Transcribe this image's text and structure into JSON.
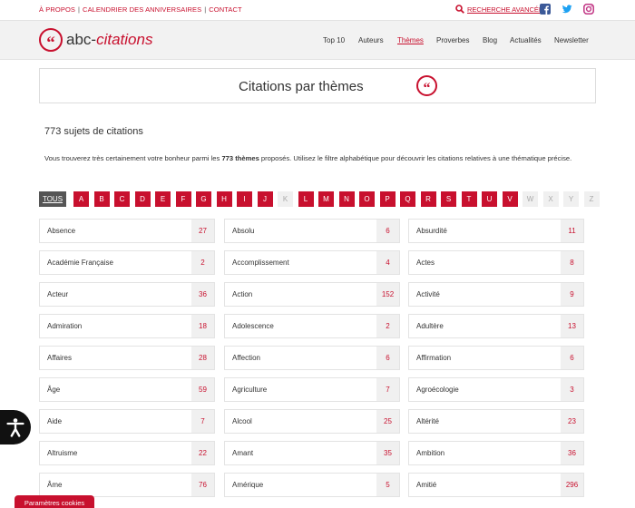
{
  "topbar": {
    "links": [
      "À PROPOS",
      "CALENDRIER DES ANNIVERSAIRES",
      "CONTACT"
    ],
    "search_label": "RECHERCHE AVANCÉE"
  },
  "header": {
    "logo_prefix": "abc-",
    "logo_highlight": "citations",
    "logo_mark": "“",
    "nav": [
      "Top 10",
      "Auteurs",
      "Thèmes",
      "Proverbes",
      "Blog",
      "Actualités",
      "Newsletter"
    ],
    "active_nav": "Thèmes"
  },
  "page": {
    "title": "Citations par thèmes",
    "title_mark": "“",
    "count_title": "773 sujets de citations",
    "intro_before": "Vous trouverez très certainement votre bonheur parmi les ",
    "intro_bold": "773 thèmes",
    "intro_after": " proposés. Utilisez le filtre alphabétique pour découvrir les citations relatives à une thématique précise."
  },
  "letters": {
    "tous": "TOUS",
    "items": [
      "A",
      "B",
      "C",
      "D",
      "E",
      "F",
      "G",
      "H",
      "I",
      "J",
      "K",
      "L",
      "M",
      "N",
      "O",
      "P",
      "Q",
      "R",
      "S",
      "T",
      "U",
      "V",
      "W",
      "X",
      "Y",
      "Z"
    ],
    "disabled": [
      "K",
      "W",
      "X",
      "Y",
      "Z"
    ]
  },
  "themes": [
    {
      "name": "Absence",
      "count": "27"
    },
    {
      "name": "Absolu",
      "count": "6"
    },
    {
      "name": "Absurdité",
      "count": "11"
    },
    {
      "name": "Académie Française",
      "count": "2"
    },
    {
      "name": "Accomplissement",
      "count": "4"
    },
    {
      "name": "Actes",
      "count": "8"
    },
    {
      "name": "Acteur",
      "count": "36"
    },
    {
      "name": "Action",
      "count": "152"
    },
    {
      "name": "Activité",
      "count": "9"
    },
    {
      "name": "Admiration",
      "count": "18"
    },
    {
      "name": "Adolescence",
      "count": "2"
    },
    {
      "name": "Adultère",
      "count": "13"
    },
    {
      "name": "Affaires",
      "count": "28"
    },
    {
      "name": "Affection",
      "count": "6"
    },
    {
      "name": "Affirmation",
      "count": "6"
    },
    {
      "name": "Âge",
      "count": "59"
    },
    {
      "name": "Agriculture",
      "count": "7"
    },
    {
      "name": "Agroécologie",
      "count": "3"
    },
    {
      "name": "Aide",
      "count": "7"
    },
    {
      "name": "Alcool",
      "count": "25"
    },
    {
      "name": "Altérité",
      "count": "23"
    },
    {
      "name": "Altruisme",
      "count": "22"
    },
    {
      "name": "Amant",
      "count": "35"
    },
    {
      "name": "Ambition",
      "count": "36"
    },
    {
      "name": "Âme",
      "count": "76"
    },
    {
      "name": "Amérique",
      "count": "5"
    },
    {
      "name": "Amitié",
      "count": "296"
    }
  ],
  "cookies_label": "Paramètres cookies",
  "colors": {
    "accent": "#c8102e",
    "header_bg": "#f2f2f2",
    "count_bg": "#f0f0f0"
  },
  "icons": [
    "search-icon",
    "facebook-icon",
    "twitter-icon",
    "instagram-icon",
    "accessibility-icon"
  ]
}
